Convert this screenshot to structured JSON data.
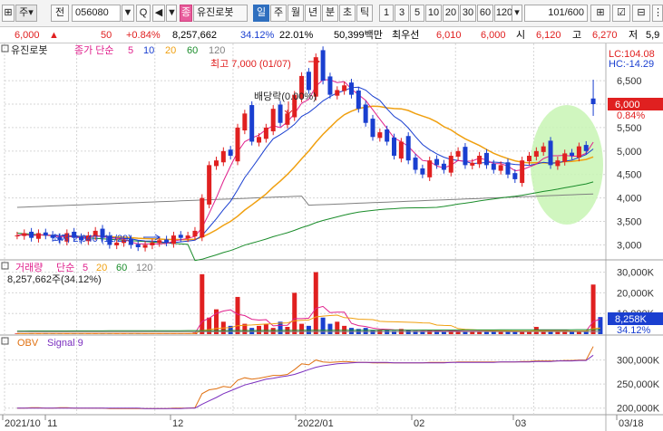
{
  "toolbar": {
    "market_label": "주",
    "prev_label": "전",
    "code_value": "056080",
    "code_dropdown_label": "▼",
    "search_label": "Q",
    "speaker_label": "◀",
    "speaker_dropdown_label": "▼",
    "stock_badge": "종",
    "stock_name": "유진로봇",
    "periods": [
      "일",
      "주",
      "월",
      "년",
      "분",
      "초",
      "틱"
    ],
    "selected_period": "일",
    "intervals": [
      "1",
      "3",
      "5",
      "10",
      "20",
      "30",
      "60",
      "120"
    ],
    "pages": "101/600"
  },
  "quote": {
    "price": "6,000",
    "arrow": "▲",
    "change": "50",
    "change_pct": "+0.84%",
    "volume": "8,257,662",
    "vol_ratio": "34.12%",
    "turnover": "22.01%",
    "amount": "50,399백만",
    "best_bid_label": "최우선",
    "best_bid": "6,010",
    "best_ask": "6,000",
    "open_label": "시",
    "open": "6,120",
    "high_label": "고",
    "high": "6,270",
    "low_label": "저",
    "low": "5,9"
  },
  "legend": {
    "stock_name": "유진로봇",
    "ma_label": "종가 단순",
    "ma_periods": [
      "5",
      "10",
      "20",
      "60",
      "120"
    ]
  },
  "annotations": {
    "high": "최고 7,000 (01/07)",
    "low": "최저 2,940 (11/29)",
    "dividend": "배당락(0.00%)",
    "lc": "LC:104.08",
    "hc": "HC:-14.29",
    "last_price": "6,000",
    "last_pct": "0.84%"
  },
  "volume_panel": {
    "label": "거래량",
    "ma_label": "단순",
    "ma_periods": [
      "5",
      "20",
      "60",
      "120"
    ],
    "current_value": "8,257,662주(34.12%)",
    "last_box": "8,258K",
    "last_pct": "34.12%"
  },
  "obv_panel": {
    "label": "OBV",
    "signal_label": "Signal 9"
  },
  "x_axis": [
    "2021/10",
    "11",
    "12",
    "2022/01",
    "02",
    "03",
    "03/18"
  ],
  "colors": {
    "up": "#e02020",
    "down": "#1a3fd0",
    "ma5": "#e0208c",
    "ma10": "#1a3fd0",
    "ma20": "#f0a010",
    "ma60": "#1a8c2a",
    "ma120": "#808080",
    "highlight": "#c8f5b4"
  },
  "chart_data": [
    {
      "type": "candlestick",
      "y_ticks": [
        3000,
        3500,
        4000,
        4500,
        5000,
        5500,
        6000,
        6500
      ],
      "ylim": [
        2700,
        7100
      ],
      "price_series": {
        "note_days": "approx daily closes",
        "close": [
          3200,
          3250,
          3150,
          3250,
          3200,
          3150,
          3100,
          3250,
          3150,
          3100,
          3200,
          3300,
          3150,
          3000,
          3050,
          3100,
          3000,
          2950,
          3000,
          3050,
          3100,
          3050,
          3200,
          3150,
          3200,
          3300,
          4000,
          4700,
          4800,
          5000,
          4900,
          5500,
          5800,
          5200,
          5300,
          5500,
          5900,
          5600,
          5800,
          6200,
          6600,
          6300,
          7000,
          6500,
          6200,
          6300,
          6400,
          6200,
          5900,
          5600,
          5300,
          5400,
          5200,
          4900,
          5200,
          4800,
          4600,
          4500,
          4800,
          4700,
          4600,
          4900,
          5000,
          4700,
          4750,
          4900,
          4700,
          4600,
          4700,
          4500,
          4400,
          4800,
          4900,
          5000,
          5100,
          4700,
          4800,
          4950,
          4900,
          5100,
          5000,
          6000
        ]
      },
      "last_price": 6000
    },
    {
      "type": "bar",
      "title": "거래량",
      "y_ticks_k": [
        10000,
        20000,
        30000
      ],
      "volume_k": [
        300,
        250,
        400,
        200,
        500,
        300,
        200,
        350,
        400,
        300,
        250,
        200,
        300,
        400,
        350,
        250,
        300,
        200,
        300,
        250,
        200,
        300,
        350,
        250,
        300,
        800,
        29000,
        8000,
        12000,
        6000,
        4000,
        18000,
        5000,
        3000,
        4000,
        5000,
        3000,
        6000,
        3500,
        20000,
        5000,
        4000,
        30000,
        8000,
        5000,
        6000,
        4000,
        3000,
        2500,
        3000,
        2000,
        1800,
        2000,
        1500,
        2500,
        1800,
        1500,
        1400,
        1600,
        1500,
        1300,
        1800,
        1500,
        1200,
        1300,
        1500,
        1400,
        1200,
        1300,
        1100,
        1200,
        1500,
        1300,
        3500,
        1400,
        1200,
        1500,
        1800,
        1300,
        1500,
        1600,
        24000,
        8258
      ]
    },
    {
      "type": "line",
      "title": "OBV",
      "y_ticks_k": [
        200000,
        250000,
        300000
      ],
      "series": [
        {
          "name": "OBV",
          "values": [
            200,
            200,
            201,
            201,
            200,
            200,
            201,
            201,
            200,
            200,
            200,
            200,
            200,
            199,
            199,
            199,
            199,
            199,
            199,
            199,
            199,
            199,
            200,
            200,
            200,
            201,
            230,
            238,
            240,
            245,
            243,
            258,
            263,
            260,
            262,
            265,
            268,
            268,
            270,
            280,
            292,
            290,
            300,
            296,
            295,
            296,
            297,
            296,
            295,
            295,
            294,
            294,
            294,
            294,
            294,
            294,
            294,
            294,
            295,
            295,
            295,
            295,
            296,
            296,
            296,
            296,
            296,
            296,
            296,
            296,
            296,
            297,
            297,
            298,
            298,
            298,
            298,
            299,
            299,
            300,
            300,
            328
          ]
        },
        {
          "name": "Signal 9",
          "values": [
            200,
            200,
            200,
            200,
            200,
            200,
            200,
            200,
            200,
            200,
            200,
            200,
            200,
            200,
            200,
            200,
            200,
            200,
            199,
            199,
            199,
            199,
            199,
            199,
            200,
            200,
            208,
            215,
            222,
            230,
            236,
            242,
            248,
            252,
            256,
            260,
            262,
            265,
            267,
            270,
            275,
            280,
            285,
            288,
            290,
            292,
            293,
            294,
            295,
            295,
            295,
            295,
            295,
            294,
            294,
            294,
            294,
            294,
            294,
            294,
            294,
            295,
            295,
            295,
            295,
            295,
            295,
            295,
            296,
            296,
            296,
            296,
            296,
            297,
            297,
            297,
            298,
            298,
            298,
            299,
            299,
            310
          ]
        }
      ]
    }
  ]
}
